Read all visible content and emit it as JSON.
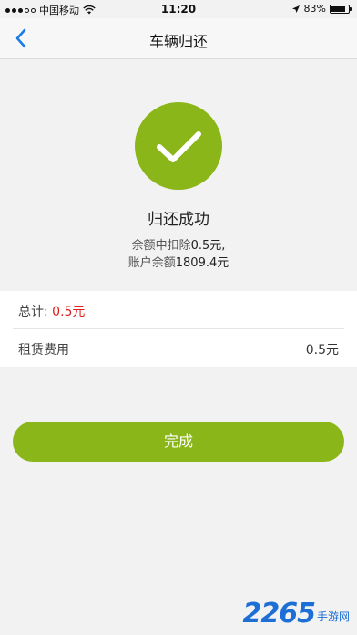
{
  "status_bar": {
    "carrier": "中国移动",
    "time": "11:20",
    "battery_percent": "83%",
    "battery_level": 0.83
  },
  "nav": {
    "title": "车辆归还",
    "back_icon": "chevron-left-icon"
  },
  "result": {
    "icon": "check-icon",
    "title": "归还成功",
    "deduct_prefix": "余额中扣除",
    "deduct_amount": "0.5元,",
    "balance_prefix": "账户余额",
    "balance_amount": "1809.4元"
  },
  "fees": {
    "total_label": "总计:",
    "total_value": "0.5元",
    "items": [
      {
        "label": "租赁费用",
        "value": "0.5元"
      }
    ]
  },
  "done_button": "完成",
  "watermark": {
    "digits": "2265",
    "text": "手游网"
  },
  "colors": {
    "accent_green": "#8ab619",
    "back_blue": "#1a7ce6",
    "total_red": "#e02020"
  }
}
